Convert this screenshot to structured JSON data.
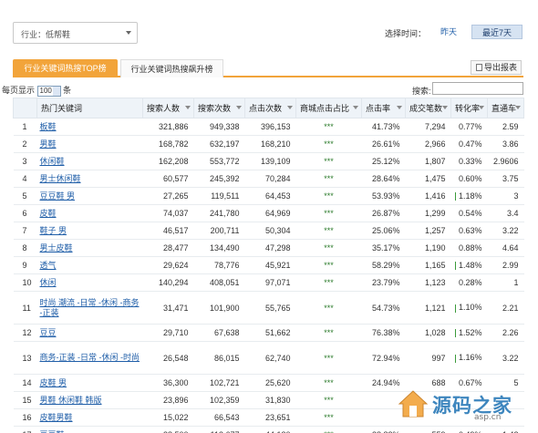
{
  "filter": {
    "industry_label": "行业：低帮鞋"
  },
  "time": {
    "label": "选择时间：",
    "yesterday": "昨天",
    "last7": "最近7天"
  },
  "tabs": {
    "active": "行业关键词热搜TOP榜",
    "inactive": "行业关键词热搜飙升榜",
    "export": "导出报表"
  },
  "controls": {
    "per_page_prefix": "每页显示",
    "per_page_value": "100",
    "per_page_suffix": "条",
    "search_label": "搜索:"
  },
  "columns": [
    "",
    "热门关键词",
    "搜索人数",
    "搜索次数",
    "点击次数",
    "商城点击占比",
    "点击率",
    "成交笔数",
    "转化率",
    "直通车"
  ],
  "rows": [
    [
      "1",
      "板鞋",
      "321,886",
      "949,338",
      "396,153",
      "***",
      "41.73%",
      "7,294",
      "0.77%",
      "2.59"
    ],
    [
      "2",
      "男鞋",
      "168,782",
      "632,197",
      "168,210",
      "***",
      "26.61%",
      "2,966",
      "0.47%",
      "3.86"
    ],
    [
      "3",
      "休闲鞋",
      "162,208",
      "553,772",
      "139,109",
      "***",
      "25.12%",
      "1,807",
      "0.33%",
      "2.9606"
    ],
    [
      "4",
      "男士休闲鞋",
      "60,577",
      "245,392",
      "70,284",
      "***",
      "28.64%",
      "1,475",
      "0.60%",
      "3.75"
    ],
    [
      "5",
      "豆豆鞋 男",
      "27,265",
      "119,511",
      "64,453",
      "***",
      "53.93%",
      "1,416",
      "1.18%",
      "3"
    ],
    [
      "6",
      "皮鞋",
      "74,037",
      "241,780",
      "64,969",
      "***",
      "26.87%",
      "1,299",
      "0.54%",
      "3.4"
    ],
    [
      "7",
      "鞋子 男",
      "46,517",
      "200,711",
      "50,304",
      "***",
      "25.06%",
      "1,257",
      "0.63%",
      "3.22"
    ],
    [
      "8",
      "男士皮鞋",
      "28,477",
      "134,490",
      "47,298",
      "***",
      "35.17%",
      "1,190",
      "0.88%",
      "4.64"
    ],
    [
      "9",
      "透气",
      "29,624",
      "78,776",
      "45,921",
      "***",
      "58.29%",
      "1,165",
      "1.48%",
      "2.99"
    ],
    [
      "10",
      "休闲",
      "140,294",
      "408,051",
      "97,071",
      "***",
      "23.79%",
      "1,123",
      "0.28%",
      "1"
    ],
    [
      "11",
      "时尚 潮流 -日常 -休闲 -商务 -正装",
      "31,471",
      "101,900",
      "55,765",
      "***",
      "54.73%",
      "1,121",
      "1.10%",
      "2.21"
    ],
    [
      "12",
      "豆豆",
      "29,710",
      "67,638",
      "51,662",
      "***",
      "76.38%",
      "1,028",
      "1.52%",
      "2.26"
    ],
    [
      "13",
      "商务-正装 -日常 -休闲 -时尚",
      "26,548",
      "86,015",
      "62,740",
      "***",
      "72.94%",
      "997",
      "1.16%",
      "3.22"
    ],
    [
      "14",
      "皮鞋 男",
      "36,300",
      "102,721",
      "25,620",
      "***",
      "24.94%",
      "688",
      "0.67%",
      "5"
    ],
    [
      "15",
      "男鞋 休闲鞋 韩版",
      "23,896",
      "102,359",
      "31,830",
      "***",
      "",
      "",
      "",
      ""
    ],
    [
      "16",
      "皮鞋男鞋",
      "15,022",
      "66,543",
      "23,651",
      "***",
      "",
      "",
      "",
      ""
    ],
    [
      "17",
      "豆豆鞋",
      "38,500",
      "113,677",
      "44,130",
      "***",
      "38.82%",
      "559",
      "0.49%",
      "1.42"
    ]
  ],
  "bar_rows": [
    5,
    9,
    11,
    12,
    13
  ],
  "watermark": {
    "text": "源码之家",
    "sub": "asp.cn"
  }
}
